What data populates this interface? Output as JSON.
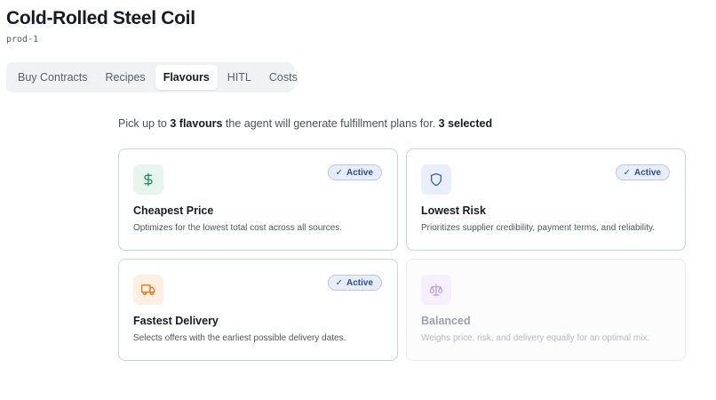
{
  "header": {
    "title": "Cold-Rolled Steel Coil",
    "product_id": "prod-1"
  },
  "tabs": [
    {
      "label": "Buy Contracts",
      "active": false
    },
    {
      "label": "Recipes",
      "active": false
    },
    {
      "label": "Flavours",
      "active": true
    },
    {
      "label": "HITL",
      "active": false
    },
    {
      "label": "Costs",
      "active": false
    }
  ],
  "intro": {
    "prefix": "Pick up to",
    "limit": "3 flavours",
    "middle": "the agent will generate fulfillment plans for.",
    "selected": "3 selected"
  },
  "flavours": [
    {
      "title": "Cheapest Price",
      "description": "Optimizes for the lowest total cost across all sources.",
      "active": true,
      "badge": "Active",
      "icon": "dollar-icon",
      "icon_color": "#1f8f5f",
      "icon_bg": "#e6f5ee"
    },
    {
      "title": "Lowest Risk",
      "description": "Prioritizes supplier credibility, payment terms, and reliability.",
      "active": true,
      "badge": "Active",
      "icon": "shield-icon",
      "icon_color": "#3a63b8",
      "icon_bg": "#e8eefa"
    },
    {
      "title": "Fastest Delivery",
      "description": "Selects offers with the earliest possible delivery dates.",
      "active": true,
      "badge": "Active",
      "icon": "truck-icon",
      "icon_color": "#e07a1f",
      "icon_bg": "#fdf0e3"
    },
    {
      "title": "Balanced",
      "description": "Weighs price, risk, and delivery equally for an optimal mix.",
      "active": false,
      "badge": "",
      "icon": "scale-icon",
      "icon_color": "#b79be0",
      "icon_bg": "#f5f0fb"
    }
  ],
  "colors": {
    "accent": "#2d4f8f",
    "active_border": "#c4d3ec"
  }
}
